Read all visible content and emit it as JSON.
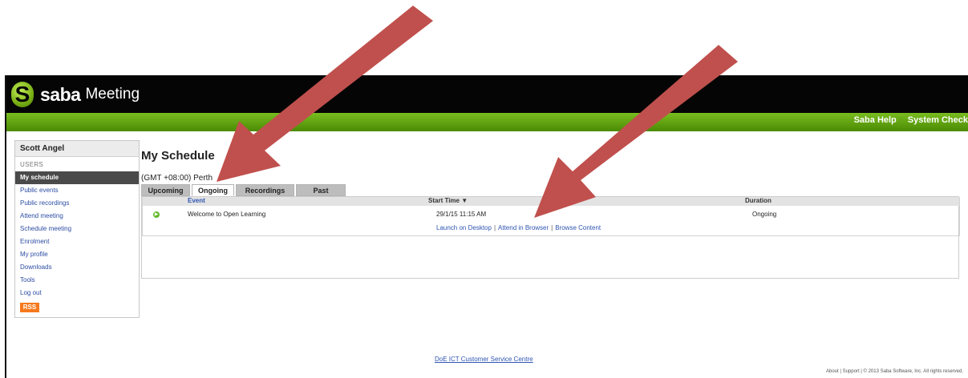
{
  "app": {
    "brand": "saba",
    "product": "Meeting",
    "nav_links": [
      "Saba Help",
      "System Check"
    ]
  },
  "sidebar": {
    "user": "Scott Angel",
    "section": "USERS",
    "items": [
      {
        "label": "My schedule",
        "active": true
      },
      {
        "label": "Public events"
      },
      {
        "label": "Public recordings"
      },
      {
        "label": "Attend meeting"
      },
      {
        "label": "Schedule meeting"
      },
      {
        "label": "Enrolment"
      },
      {
        "label": "My profile"
      },
      {
        "label": "Downloads"
      },
      {
        "label": "Tools"
      },
      {
        "label": "Log out"
      }
    ],
    "rss": "RSS"
  },
  "schedule": {
    "title": "My Schedule",
    "timezone": "(GMT +08:00) Perth",
    "tabs": [
      {
        "label": "Upcoming"
      },
      {
        "label": "Ongoing",
        "active": true
      },
      {
        "label": "Recordings"
      },
      {
        "label": "Past"
      }
    ],
    "columns": {
      "event": "Event",
      "start": "Start Time ▼",
      "duration": "Duration"
    },
    "row": {
      "status_icon": "play-icon",
      "event": "Welcome to Open Learning",
      "start": "29/1/15 11:15 AM",
      "duration": "Ongoing",
      "links": [
        "Launch on Desktop",
        "Attend in Browser",
        "Browse Content"
      ]
    }
  },
  "footer": {
    "link": "DoE ICT Customer Service Centre",
    "copyright": "About | Support | © 2013 Saba Software, Inc. All rights reserved."
  },
  "colors": {
    "topbar": "#050505",
    "greenbar": "#5ca112",
    "arrow": "#c0504d",
    "link": "#2f55b2",
    "rss": "#f6791d"
  }
}
